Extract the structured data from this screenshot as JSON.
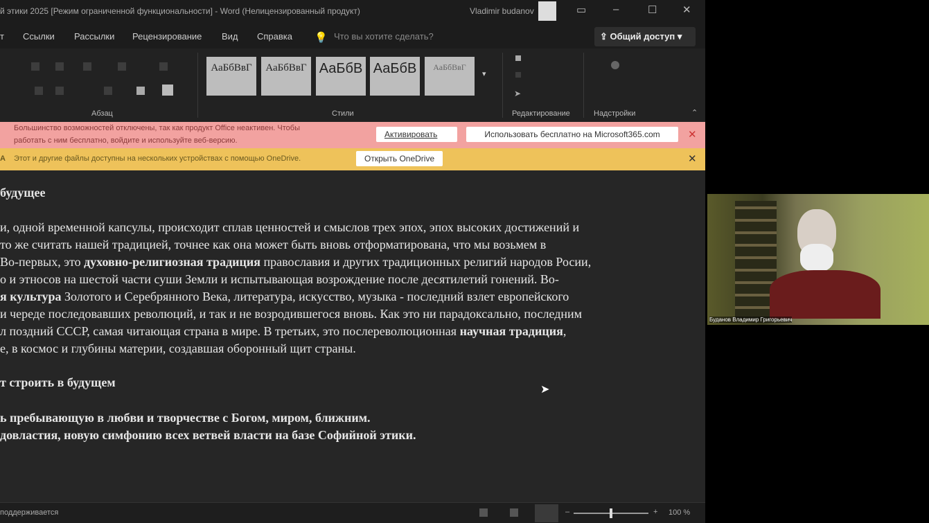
{
  "window": {
    "title": "й этики 2025 [Режим ограниченной функциональности]  -  Word (Нелицензированный продукт)",
    "user": "Vladimir budanov"
  },
  "menu": {
    "items": [
      "т",
      "Ссылки",
      "Рассылки",
      "Рецензирование",
      "Вид",
      "Справка"
    ],
    "search_placeholder": "Что вы хотите сделать?",
    "share": "Общий доступ"
  },
  "ribbon": {
    "styles": [
      "АаБбВвГ",
      "АаБбВвГ",
      "АаБбВ",
      "АаБбВ",
      "АаБбВвГ"
    ],
    "groups": {
      "paragraph": "Абзац",
      "styles": "Стили",
      "editing": "Редактирование",
      "addins": "Надстройки"
    }
  },
  "banners": {
    "activation": {
      "text_line1": "Большинство возможностей отключены, так как продукт Office неактивен. Чтобы",
      "text_line2": "работать с ним бесплатно, войдите и используйте веб-версию.",
      "activate": "Активировать",
      "use_free": "Использовать бесплатно на Microsoft365.com"
    },
    "onedrive": {
      "prefix": "A",
      "text": "Этот и другие файлы доступны на нескольких устройствах с помощью OneDrive.",
      "button": "Открыть OneDrive"
    }
  },
  "document": {
    "heading1": "будущее",
    "lines": [
      [
        "и, одной временной капсулы, происходит сплав ценностей и смыслов трех эпох, эпох высоких достижений и"
      ],
      [
        "то же считать нашей традицией, точнее как она может быть вновь отформатирована, что мы возьмем в"
      ],
      [
        "Во-первых, это ",
        "духовно-религиозная традиция",
        " православия и других традиционных религий народов Росии,"
      ],
      [
        "о и этносов на шестой части суши Земли и испытывающая возрождение после десятилетий гонений. Во-"
      ],
      [
        "",
        "я культура",
        " Золотого и Серебрянного Века, литература, искусство, музыка -  последний взлет европейского"
      ],
      [
        "и череде последовавших революций, и так и не возродившегося вновь. Как это ни парадоксально, последним"
      ],
      [
        "л поздний СССР, самая читающая страна в мире. В третьих, это послереволюционная ",
        "научная традиция",
        ","
      ],
      [
        "е, в космос и глубины материи, создавшая оборонный щит страны."
      ]
    ],
    "heading2": "т строить в будущем",
    "bold1": "ь пребывающую в любви и творчестве с Богом, миром, ближним.",
    "bold2": "довластия, новую симфонию всех ветвей власти на базе Софийной этики."
  },
  "status": {
    "left": "поддерживается",
    "zoom": "100 %",
    "zoom_fraction": 0.5
  },
  "video": {
    "caption": "Буданов Владимир Григорьевич"
  }
}
